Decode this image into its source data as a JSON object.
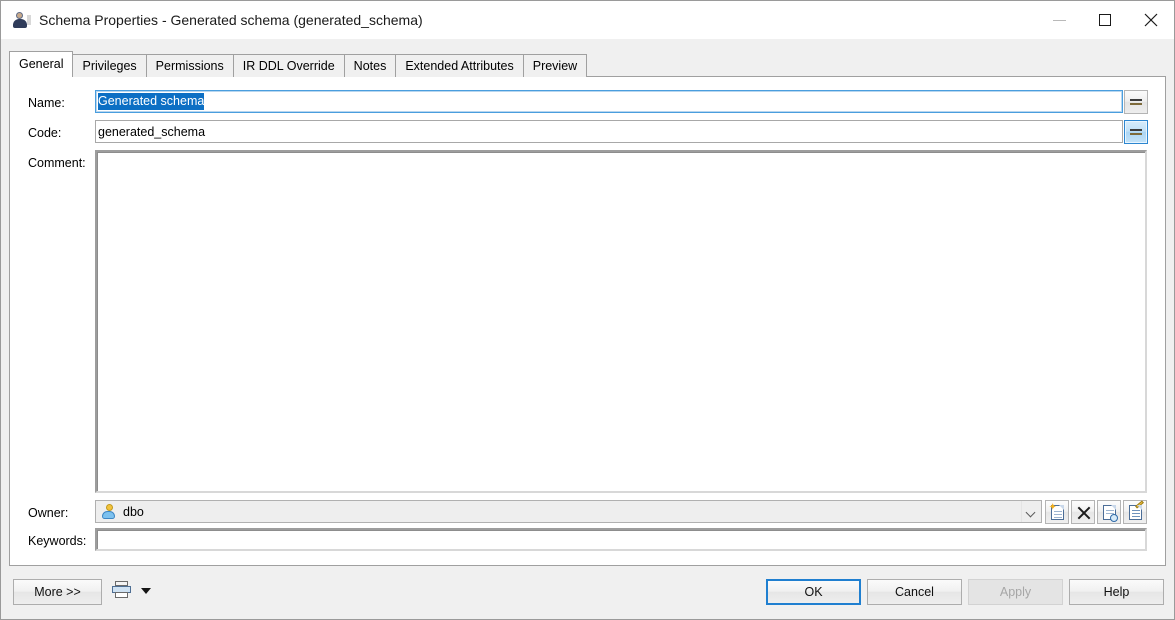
{
  "window": {
    "title": "Schema Properties - Generated schema (generated_schema)",
    "icon": "user-schema-icon",
    "controls": {
      "minimize": "minimize-icon",
      "maximize": "maximize-icon",
      "close": "close-icon"
    }
  },
  "tabs": [
    {
      "label": "General",
      "active": true
    },
    {
      "label": "Privileges",
      "active": false
    },
    {
      "label": "Permissions",
      "active": false
    },
    {
      "label": "IR DDL Override",
      "active": false
    },
    {
      "label": "Notes",
      "active": false
    },
    {
      "label": "Extended Attributes",
      "active": false
    },
    {
      "label": "Preview",
      "active": false
    }
  ],
  "form": {
    "name": {
      "label": "Name:",
      "value": "Generated schema",
      "selected": true,
      "focused": true
    },
    "code": {
      "label": "Code:",
      "value": "generated_schema",
      "focused": false
    },
    "comment": {
      "label": "Comment:",
      "value": ""
    },
    "owner": {
      "label": "Owner:",
      "value": "dbo",
      "icon": "user-icon",
      "actions": [
        {
          "name": "create-owner-button",
          "icon": "new-page-icon"
        },
        {
          "name": "delete-owner-button",
          "icon": "x-delete-icon"
        },
        {
          "name": "browse-owner-button",
          "icon": "magnifier-page-icon"
        },
        {
          "name": "owner-properties-button",
          "icon": "properties-page-icon"
        }
      ]
    },
    "keywords": {
      "label": "Keywords:",
      "value": ""
    },
    "equals_buttons": {
      "name_button": "=",
      "code_button": "="
    }
  },
  "footer": {
    "more_label": "More >>",
    "print_icon": "printer-icon",
    "print_dropdown": "dropdown-arrow-icon",
    "ok_label": "OK",
    "cancel_label": "Cancel",
    "apply_label": "Apply",
    "apply_enabled": false,
    "help_label": "Help"
  },
  "colors": {
    "accent": "#0c6fc4",
    "focus_border": "#1f7fd0",
    "dialog_bg": "#f0f0f0",
    "panel_bg": "#ffffff"
  }
}
